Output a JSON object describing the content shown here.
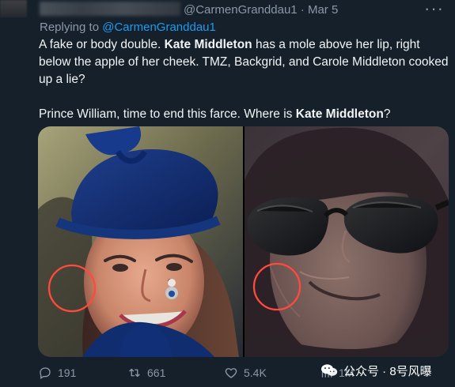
{
  "tweet": {
    "handle": "@CarmenGranddau1 · Mar 5",
    "more_icon": "more-icon",
    "reply_to_prefix": "Replying to ",
    "reply_to_handle": "@CarmenGranddau1",
    "text": {
      "p1_a": "A fake or body double. ",
      "p1_b": "Kate Middleton",
      "p1_c": " has a mole above her lip, right below the apple of her cheek. TMZ, Backgrid, and Carole Middleton cooked up a lie?",
      "p2_a": "Prince William, time to end this farce. Where is ",
      "p2_b": "Kate Middleton",
      "p2_c": "?"
    },
    "actions": {
      "reply_count": "191",
      "retweet_count": "661",
      "like_count": "5.4K",
      "view_label": "1M"
    }
  },
  "watermark": {
    "text": "公众号 · 8号风曝"
  },
  "colors": {
    "background": "#15202b",
    "text": "#e7e9ea",
    "secondary_text": "#8b98a5",
    "accent": "#1d9bf0",
    "highlight_circle": "#ff4a3d"
  },
  "icons": {
    "reply": "reply-icon",
    "retweet": "retweet-icon",
    "like": "heart-icon",
    "views": "views-icon",
    "watermark": "wechat-icon"
  }
}
